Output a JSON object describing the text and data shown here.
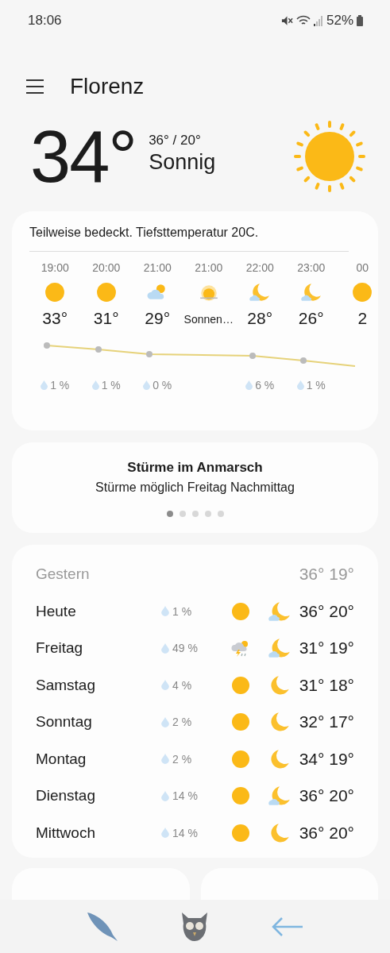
{
  "status_bar": {
    "time": "18:06",
    "battery": "52%"
  },
  "header": {
    "city": "Florenz"
  },
  "current": {
    "temperature": "34°",
    "high_low": "36° / 20°",
    "condition": "Sonnig",
    "kind": "sun"
  },
  "hourly": {
    "summary": "Teilweise bedeckt. Tiefsttemperatur 20C.",
    "hours": [
      {
        "time": "19:00",
        "kind": "sun",
        "value": "33°",
        "precip": "1 %"
      },
      {
        "time": "20:00",
        "kind": "sun",
        "value": "31°",
        "precip": "1 %"
      },
      {
        "time": "21:00",
        "kind": "cloud-sun",
        "value": "29°",
        "precip": "0 %"
      },
      {
        "time": "21:00",
        "kind": "sunset",
        "value": "Sonnen…"
      },
      {
        "time": "22:00",
        "kind": "moon-cloud",
        "value": "28°",
        "precip": "6 %"
      },
      {
        "time": "23:00",
        "kind": "moon-cloud",
        "value": "26°",
        "precip": "1 %"
      },
      {
        "time": "00",
        "kind": "sun",
        "value": "2"
      }
    ]
  },
  "alert": {
    "title": "Stürme im Anmarsch",
    "text": "Stürme möglich Freitag Nachmittag",
    "dots": [
      {
        "selected": true
      },
      {
        "selected": false
      },
      {
        "selected": false
      },
      {
        "selected": false
      },
      {
        "selected": false
      }
    ]
  },
  "daily": {
    "yesterday": {
      "label": "Gestern",
      "temps": "36° 19°"
    },
    "days": [
      {
        "name": "Heute",
        "precip": "1 %",
        "day": {
          "kind": "sun"
        },
        "night": {
          "kind": "moon-cloud"
        },
        "temps": "36° 20°"
      },
      {
        "name": "Freitag",
        "precip": "49 %",
        "day": {
          "kind": "storm"
        },
        "night": {
          "kind": "moon-cloud"
        },
        "temps": "31° 19°"
      },
      {
        "name": "Samstag",
        "precip": "4 %",
        "day": {
          "kind": "sun"
        },
        "night": {
          "kind": "moon"
        },
        "temps": "31° 18°"
      },
      {
        "name": "Sonntag",
        "precip": "2 %",
        "day": {
          "kind": "sun"
        },
        "night": {
          "kind": "moon"
        },
        "temps": "32° 17°"
      },
      {
        "name": "Montag",
        "precip": "2 %",
        "day": {
          "kind": "sun"
        },
        "night": {
          "kind": "moon"
        },
        "temps": "34° 19°"
      },
      {
        "name": "Dienstag",
        "precip": "14 %",
        "day": {
          "kind": "sun"
        },
        "night": {
          "kind": "moon-cloud"
        },
        "temps": "36° 20°"
      },
      {
        "name": "Mittwoch",
        "precip": "14 %",
        "day": {
          "kind": "sun"
        },
        "night": {
          "kind": "moon"
        },
        "temps": "36° 20°"
      }
    ]
  }
}
